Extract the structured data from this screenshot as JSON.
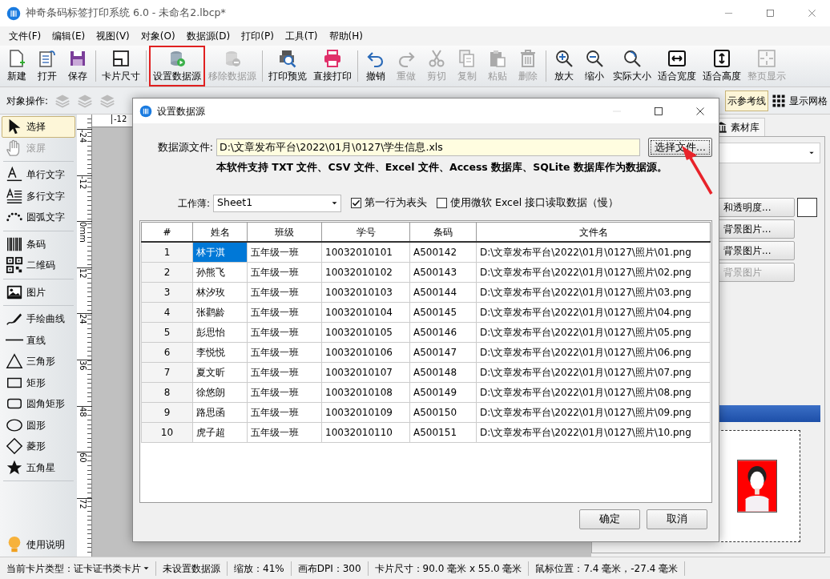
{
  "window": {
    "title": "神奇条码标签打印系统 6.0 - 未命名2.lbcp*"
  },
  "menu": [
    "文件(F)",
    "编辑(E)",
    "视图(V)",
    "对象(O)",
    "数据源(D)",
    "打印(P)",
    "工具(T)",
    "帮助(H)"
  ],
  "toolbar": [
    [
      {
        "label": "新建",
        "disabled": false,
        "selected": false
      },
      {
        "label": "打开",
        "disabled": false,
        "selected": false
      },
      {
        "label": "保存",
        "disabled": false,
        "selected": false
      }
    ],
    [
      {
        "label": "卡片尺寸",
        "disabled": false,
        "selected": false
      }
    ],
    [
      {
        "label": "设置数据源",
        "disabled": false,
        "selected": true
      },
      {
        "label": "移除数据源",
        "disabled": true,
        "selected": false
      }
    ],
    [
      {
        "label": "打印预览",
        "disabled": false,
        "selected": false
      },
      {
        "label": "直接打印",
        "disabled": false,
        "selected": false
      }
    ],
    [
      {
        "label": "撤销",
        "disabled": false,
        "selected": false
      },
      {
        "label": "重做",
        "disabled": true,
        "selected": false
      },
      {
        "label": "剪切",
        "disabled": true,
        "selected": false
      },
      {
        "label": "复制",
        "disabled": true,
        "selected": false
      },
      {
        "label": "粘贴",
        "disabled": true,
        "selected": false
      },
      {
        "label": "删除",
        "disabled": true,
        "selected": false
      }
    ],
    [
      {
        "label": "放大",
        "disabled": false,
        "selected": false
      },
      {
        "label": "缩小",
        "disabled": false,
        "selected": false
      },
      {
        "label": "实际大小",
        "disabled": false,
        "selected": false
      },
      {
        "label": "适合宽度",
        "disabled": false,
        "selected": false
      },
      {
        "label": "适合高度",
        "disabled": false,
        "selected": false
      },
      {
        "label": "整页显示",
        "disabled": true,
        "selected": false
      }
    ]
  ],
  "object_bar": {
    "label": "对象操作:",
    "toggles": [
      {
        "label": "示参考线",
        "on": true
      },
      {
        "label": "显示网格",
        "on": false
      }
    ]
  },
  "tools": [
    [
      {
        "label": "选择",
        "selected": true,
        "disabled": false
      },
      {
        "label": "滚屏",
        "selected": false,
        "disabled": true
      }
    ],
    [
      {
        "label": "单行文字",
        "selected": false,
        "disabled": false
      },
      {
        "label": "多行文字",
        "selected": false,
        "disabled": false
      },
      {
        "label": "圆弧文字",
        "selected": false,
        "disabled": false
      }
    ],
    [
      {
        "label": "条码",
        "selected": false,
        "disabled": false
      },
      {
        "label": "二维码",
        "selected": false,
        "disabled": false
      }
    ],
    [
      {
        "label": "图片",
        "selected": false,
        "disabled": false
      }
    ],
    [
      {
        "label": "手绘曲线",
        "selected": false,
        "disabled": false
      },
      {
        "label": "直线",
        "selected": false,
        "disabled": false
      },
      {
        "label": "三角形",
        "selected": false,
        "disabled": false
      },
      {
        "label": "矩形",
        "selected": false,
        "disabled": false
      },
      {
        "label": "圆角矩形",
        "selected": false,
        "disabled": false
      },
      {
        "label": "圆形",
        "selected": false,
        "disabled": false
      },
      {
        "label": "菱形",
        "selected": false,
        "disabled": false
      },
      {
        "label": "五角星",
        "selected": false,
        "disabled": false
      }
    ]
  ],
  "help": {
    "label": "使用说明"
  },
  "rulers": {
    "horizontal": [
      "-12"
    ],
    "vertical": [
      "-24",
      "-12",
      "0mm",
      "12",
      "24",
      "36",
      "48",
      "60",
      "72"
    ]
  },
  "right_panel": {
    "tab": "素材库",
    "buttons": [
      {
        "label": "和透明度...",
        "disabled": false
      },
      {
        "label": "背景图片...",
        "disabled": false
      },
      {
        "label": "背景图片...",
        "disabled": false
      },
      {
        "label": "背景图片",
        "disabled": true
      }
    ]
  },
  "dialog": {
    "title": "设置数据源",
    "file_label": "数据源文件:",
    "file_value": "D:\\文章发布平台\\2022\\01月\\0127\\学生信息.xls",
    "browse_button": "选择文件...",
    "note": "本软件支持 TXT 文件、CSV 文件、Excel 文件、Access 数据库、SQLite 数据库作为数据源。",
    "workbook_label": "工作薄:",
    "workbook_value": "Sheet1",
    "options": [
      {
        "label": "第一行为表头",
        "checked": true
      },
      {
        "label": "使用微软 Excel 接口读取数据（慢）",
        "checked": false
      }
    ],
    "table": {
      "columns": [
        "#",
        "姓名",
        "班级",
        "学号",
        "条码",
        "文件名"
      ],
      "rows": [
        {
          "selected": true,
          "cells": [
            "1",
            "林于淇",
            "五年级一班",
            "10032010101",
            "A500142",
            "D:\\文章发布平台\\2022\\01月\\0127\\照片\\01.png"
          ]
        },
        {
          "selected": false,
          "cells": [
            "2",
            "孙熊飞",
            "五年级一班",
            "10032010102",
            "A500143",
            "D:\\文章发布平台\\2022\\01月\\0127\\照片\\02.png"
          ]
        },
        {
          "selected": false,
          "cells": [
            "3",
            "林汐玫",
            "五年级一班",
            "10032010103",
            "A500144",
            "D:\\文章发布平台\\2022\\01月\\0127\\照片\\03.png"
          ]
        },
        {
          "selected": false,
          "cells": [
            "4",
            "张鹳龄",
            "五年级一班",
            "10032010104",
            "A500145",
            "D:\\文章发布平台\\2022\\01月\\0127\\照片\\04.png"
          ]
        },
        {
          "selected": false,
          "cells": [
            "5",
            "彭思怡",
            "五年级一班",
            "10032010105",
            "A500146",
            "D:\\文章发布平台\\2022\\01月\\0127\\照片\\05.png"
          ]
        },
        {
          "selected": false,
          "cells": [
            "6",
            "李悦悦",
            "五年级一班",
            "10032010106",
            "A500147",
            "D:\\文章发布平台\\2022\\01月\\0127\\照片\\06.png"
          ]
        },
        {
          "selected": false,
          "cells": [
            "7",
            "夏文昕",
            "五年级一班",
            "10032010107",
            "A500148",
            "D:\\文章发布平台\\2022\\01月\\0127\\照片\\07.png"
          ]
        },
        {
          "selected": false,
          "cells": [
            "8",
            "徐悠朗",
            "五年级一班",
            "10032010108",
            "A500149",
            "D:\\文章发布平台\\2022\\01月\\0127\\照片\\08.png"
          ]
        },
        {
          "selected": false,
          "cells": [
            "9",
            "路思函",
            "五年级一班",
            "10032010109",
            "A500150",
            "D:\\文章发布平台\\2022\\01月\\0127\\照片\\09.png"
          ]
        },
        {
          "selected": false,
          "cells": [
            "10",
            "虎子超",
            "五年级一班",
            "10032010110",
            "A500151",
            "D:\\文章发布平台\\2022\\01月\\0127\\照片\\10.png"
          ]
        }
      ]
    },
    "buttons": [
      "确定",
      "取消"
    ]
  },
  "status_bar": [
    "当前卡片类型：证卡证书类卡片",
    "未设置数据源",
    "缩放：41%",
    "画布DPI：300",
    "卡片尺寸：90.0 毫米 x 55.0 毫米",
    "鼠标位置：7.4 毫米，-27.4 毫米"
  ]
}
